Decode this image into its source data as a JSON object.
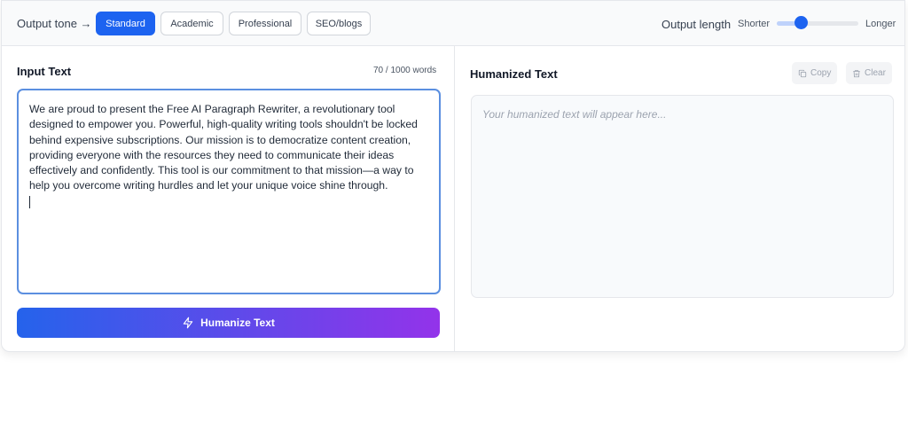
{
  "toolbar": {
    "tone_label": "Output tone →",
    "tones": [
      "Standard",
      "Academic",
      "Professional",
      "SEO/blogs"
    ],
    "selected_tone": "Standard",
    "length_label": "Output length",
    "length_min_label": "Shorter",
    "length_max_label": "Longer",
    "length_value": 0.3
  },
  "input": {
    "title": "Input Text",
    "word_count": "70 / 1000 words",
    "text": "We are proud to present the Free AI Paragraph Rewriter, a revolutionary tool designed to empower you. Powerful, high-quality writing tools shouldn't be locked behind expensive subscriptions. Our mission is to democratize content creation, providing everyone with the resources they need to communicate their ideas effectively and confidently. This tool is our commitment to that mission—a way to help you overcome writing hurdles and let your unique voice shine through.",
    "button_label": "Humanize Text",
    "button_icon": "lightning-icon"
  },
  "output": {
    "title": "Humanized Text",
    "copy_label": "Copy",
    "clear_label": "Clear",
    "placeholder": "Your humanized text will appear here..."
  },
  "colors": {
    "accent": "#1d63f0",
    "gradient_start": "#2563eb",
    "gradient_end": "#9333ea"
  }
}
